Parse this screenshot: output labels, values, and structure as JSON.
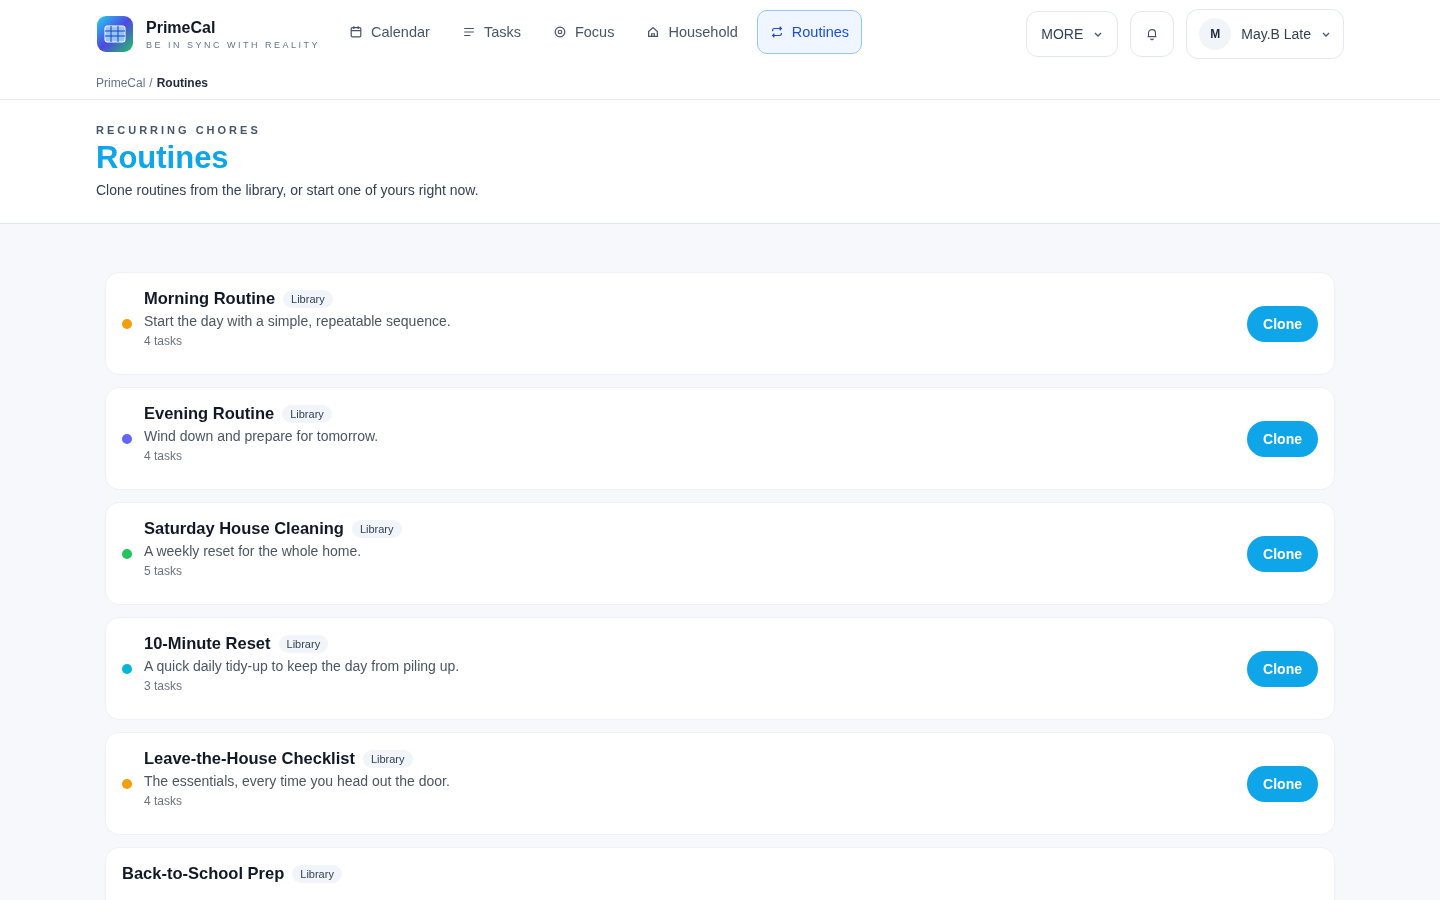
{
  "brand": {
    "name": "PrimeCal",
    "tagline": "BE IN SYNC WITH REALITY"
  },
  "nav": [
    {
      "label": "Calendar",
      "kind": "calendar",
      "selected": false
    },
    {
      "label": "Tasks",
      "kind": "list",
      "selected": false
    },
    {
      "label": "Focus",
      "kind": "focus",
      "selected": false
    },
    {
      "label": "Household",
      "kind": "household",
      "selected": false
    },
    {
      "label": "Routines",
      "kind": "routines",
      "selected": true
    }
  ],
  "more": "MORE",
  "user": {
    "initial": "M",
    "name": "May.B Late"
  },
  "breadcrumb": {
    "items": [
      "PrimeCal",
      "Routines"
    ],
    "separator": "/"
  },
  "hero": {
    "eyebrow": "RECURRING CHORES",
    "title": "Routines",
    "subtitle": "Clone routines from the library, or start one of yours right now."
  },
  "routines": [
    {
      "title": "Morning Routine",
      "badge": "Library",
      "description": "Start the day with a simple, repeatable sequence.",
      "count": "4 tasks",
      "color": "#f59e0b",
      "action": "Clone"
    },
    {
      "title": "Evening Routine",
      "badge": "Library",
      "description": "Wind down and prepare for tomorrow.",
      "count": "4 tasks",
      "color": "#6366f1",
      "action": "Clone"
    },
    {
      "title": "Saturday House Cleaning",
      "badge": "Library",
      "description": "A weekly reset for the whole home.",
      "count": "5 tasks",
      "color": "#22c55e",
      "action": "Clone"
    },
    {
      "title": "10-Minute Reset",
      "badge": "Library",
      "description": "A quick daily tidy-up to keep the day from piling up.",
      "count": "3 tasks",
      "color": "#06b6d4",
      "action": "Clone"
    },
    {
      "title": "Leave-the-House Checklist",
      "badge": "Library",
      "description": "The essentials, every time you head out the door.",
      "count": "4 tasks",
      "color": "#f59e0b",
      "action": "Clone"
    },
    {
      "title": "Back-to-School Prep",
      "badge": "Library"
    }
  ]
}
